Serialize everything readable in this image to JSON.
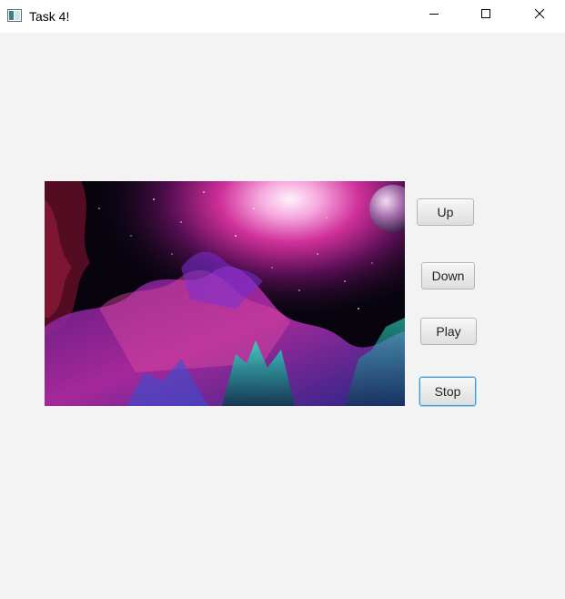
{
  "window": {
    "title": "Task 4!",
    "controls": {
      "minimize_icon": "minimize-icon",
      "maximize_icon": "maximize-icon",
      "close_icon": "close-icon"
    }
  },
  "media": {
    "description_icon": "space-nebula-image"
  },
  "buttons": {
    "up": "Up",
    "down": "Down",
    "play": "Play",
    "stop": "Stop"
  },
  "colors": {
    "background": "#f3f3f3",
    "titlebar": "#ffffff",
    "focus_border": "#3d9ad6"
  }
}
